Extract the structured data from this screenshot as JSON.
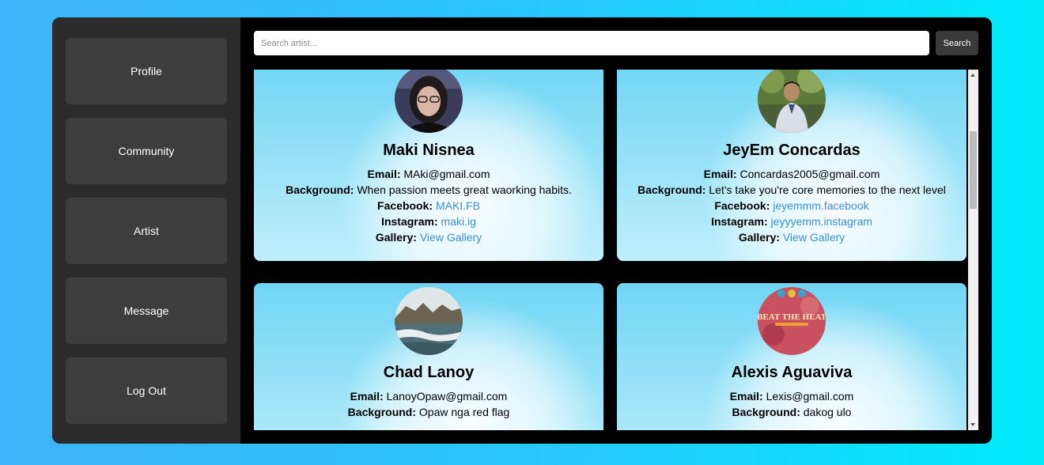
{
  "sidebar": {
    "items": [
      {
        "label": "Profile"
      },
      {
        "label": "Community"
      },
      {
        "label": "Artist"
      },
      {
        "label": "Message"
      },
      {
        "label": "Log Out"
      }
    ]
  },
  "search": {
    "placeholder": "Search artist...",
    "button_label": "Search"
  },
  "field_labels": {
    "email": "Email:",
    "background": "Background:",
    "facebook": "Facebook:",
    "instagram": "Instagram:",
    "gallery": "Gallery:"
  },
  "artists": [
    {
      "name": "Maki Nisnea",
      "email": "MAki@gmail.com",
      "background": "When passion meets great waorking habits.",
      "facebook": "MAKI.FB",
      "instagram": "maki.ig",
      "gallery": "View Gallery",
      "avatar_icon": "portrait-photo"
    },
    {
      "name": "JeyEm Concardas",
      "email": "Concardas2005@gmail.com",
      "background": "Let's take you're core memories to the next level",
      "facebook": "jeyemmm.facebook",
      "instagram": "jeyyyemm.instagram",
      "gallery": "View Gallery",
      "avatar_icon": "portrait-photo"
    },
    {
      "name": "Chad Lanoy",
      "email": "LanoyOpaw@gmail.com",
      "background": "Opaw nga red flag",
      "avatar_icon": "landscape-photo"
    },
    {
      "name": "Alexis Aguaviva",
      "email": "Lexis@gmail.com",
      "background": "dakog ulo",
      "avatar_icon": "poster-photo",
      "avatar_text": "BEAT THE HEAT"
    }
  ]
}
